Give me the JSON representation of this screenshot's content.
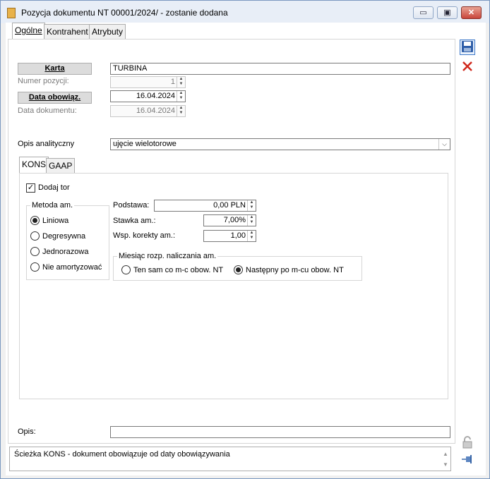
{
  "window": {
    "title": "Pozycja dokumentu NT  00001/2024/ - zostanie dodana",
    "minimize": "▭",
    "restore": "▣",
    "close": "✕"
  },
  "tabs": [
    {
      "label": "Ogólne",
      "active": true
    },
    {
      "label": "Kontrahent",
      "active": false
    },
    {
      "label": "Atrybuty",
      "active": false
    }
  ],
  "form": {
    "karta_button": "Karta",
    "karta_value": "TURBINA",
    "numer_pozycji_label": "Numer pozycji:",
    "numer_pozycji_value": "1",
    "data_obowiaz_button": "Data obowiąz.",
    "data_obowiaz_value": "16.04.2024",
    "data_dokumentu_label": "Data dokumentu:",
    "data_dokumentu_value": "16.04.2024",
    "opis_analityczny_label": "Opis analityczny",
    "opis_analityczny_value": "ujęcie wielotorowe",
    "opis_label": "Opis:",
    "opis_value": ""
  },
  "subtabs": [
    {
      "label": "KONS",
      "active": true
    },
    {
      "label": "GAAP",
      "active": false
    }
  ],
  "kons": {
    "dodaj_tor_label": "Dodaj tor",
    "dodaj_tor_checked": true,
    "metoda_title": "Metoda am.",
    "metody": [
      {
        "label": "Liniowa",
        "selected": true
      },
      {
        "label": "Degresywna",
        "selected": false
      },
      {
        "label": "Jednorazowa",
        "selected": false
      },
      {
        "label": "Nie amortyzować",
        "selected": false
      }
    ],
    "podstawa_label": "Podstawa:",
    "podstawa_value": "0,00 PLN",
    "stawka_label": "Stawka am.:",
    "stawka_value": "7,00%",
    "wsp_label": "Wsp. korekty am.:",
    "wsp_value": "1,00",
    "miesiac_title": "Miesiąc rozp. naliczania am.",
    "miesiac_options": [
      {
        "label": "Ten sam co m-c obow. NT",
        "selected": false
      },
      {
        "label": "Następny po m-cu obow. NT",
        "selected": true
      }
    ]
  },
  "status": {
    "text": "Ścieżka KONS - dokument obowiązuje od daty obowiązywania"
  },
  "icons": {
    "save": "save-icon",
    "cancel": "cancel-icon",
    "lock": "lock-icon",
    "pin": "pin-icon"
  }
}
